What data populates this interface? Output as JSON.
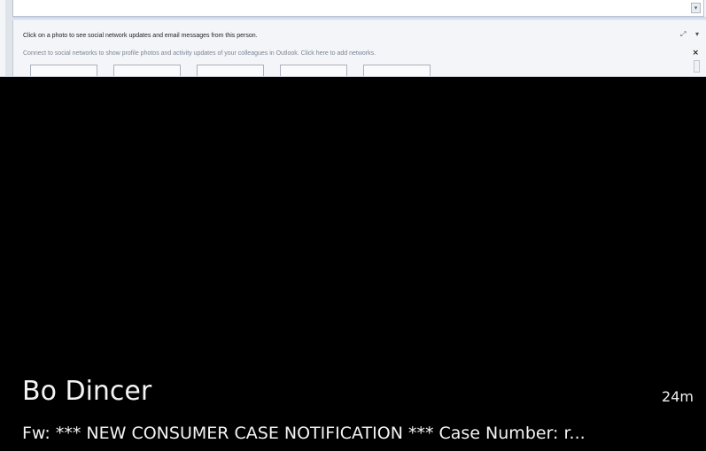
{
  "outlook": {
    "social_pane_title": "Click on a photo to see social network updates and email messages from this person.",
    "social_connect_info": "Connect to social networks to show profile photos and activity updates of your colleagues in Outlook. Click here to add networks.",
    "expand_icon": "expand-arrows-icon",
    "menu_icon": "chevron-down-icon",
    "close_glyph": "×",
    "scroll_glyph": "▾"
  },
  "notification": {
    "sender": "Bo Dincer",
    "time": "24m",
    "subject": "Fw: *** NEW CONSUMER CASE NOTIFICATION *** Case Number:  r..."
  },
  "colors": {
    "background": "#000000",
    "notification_text": "#f4f4f4"
  }
}
